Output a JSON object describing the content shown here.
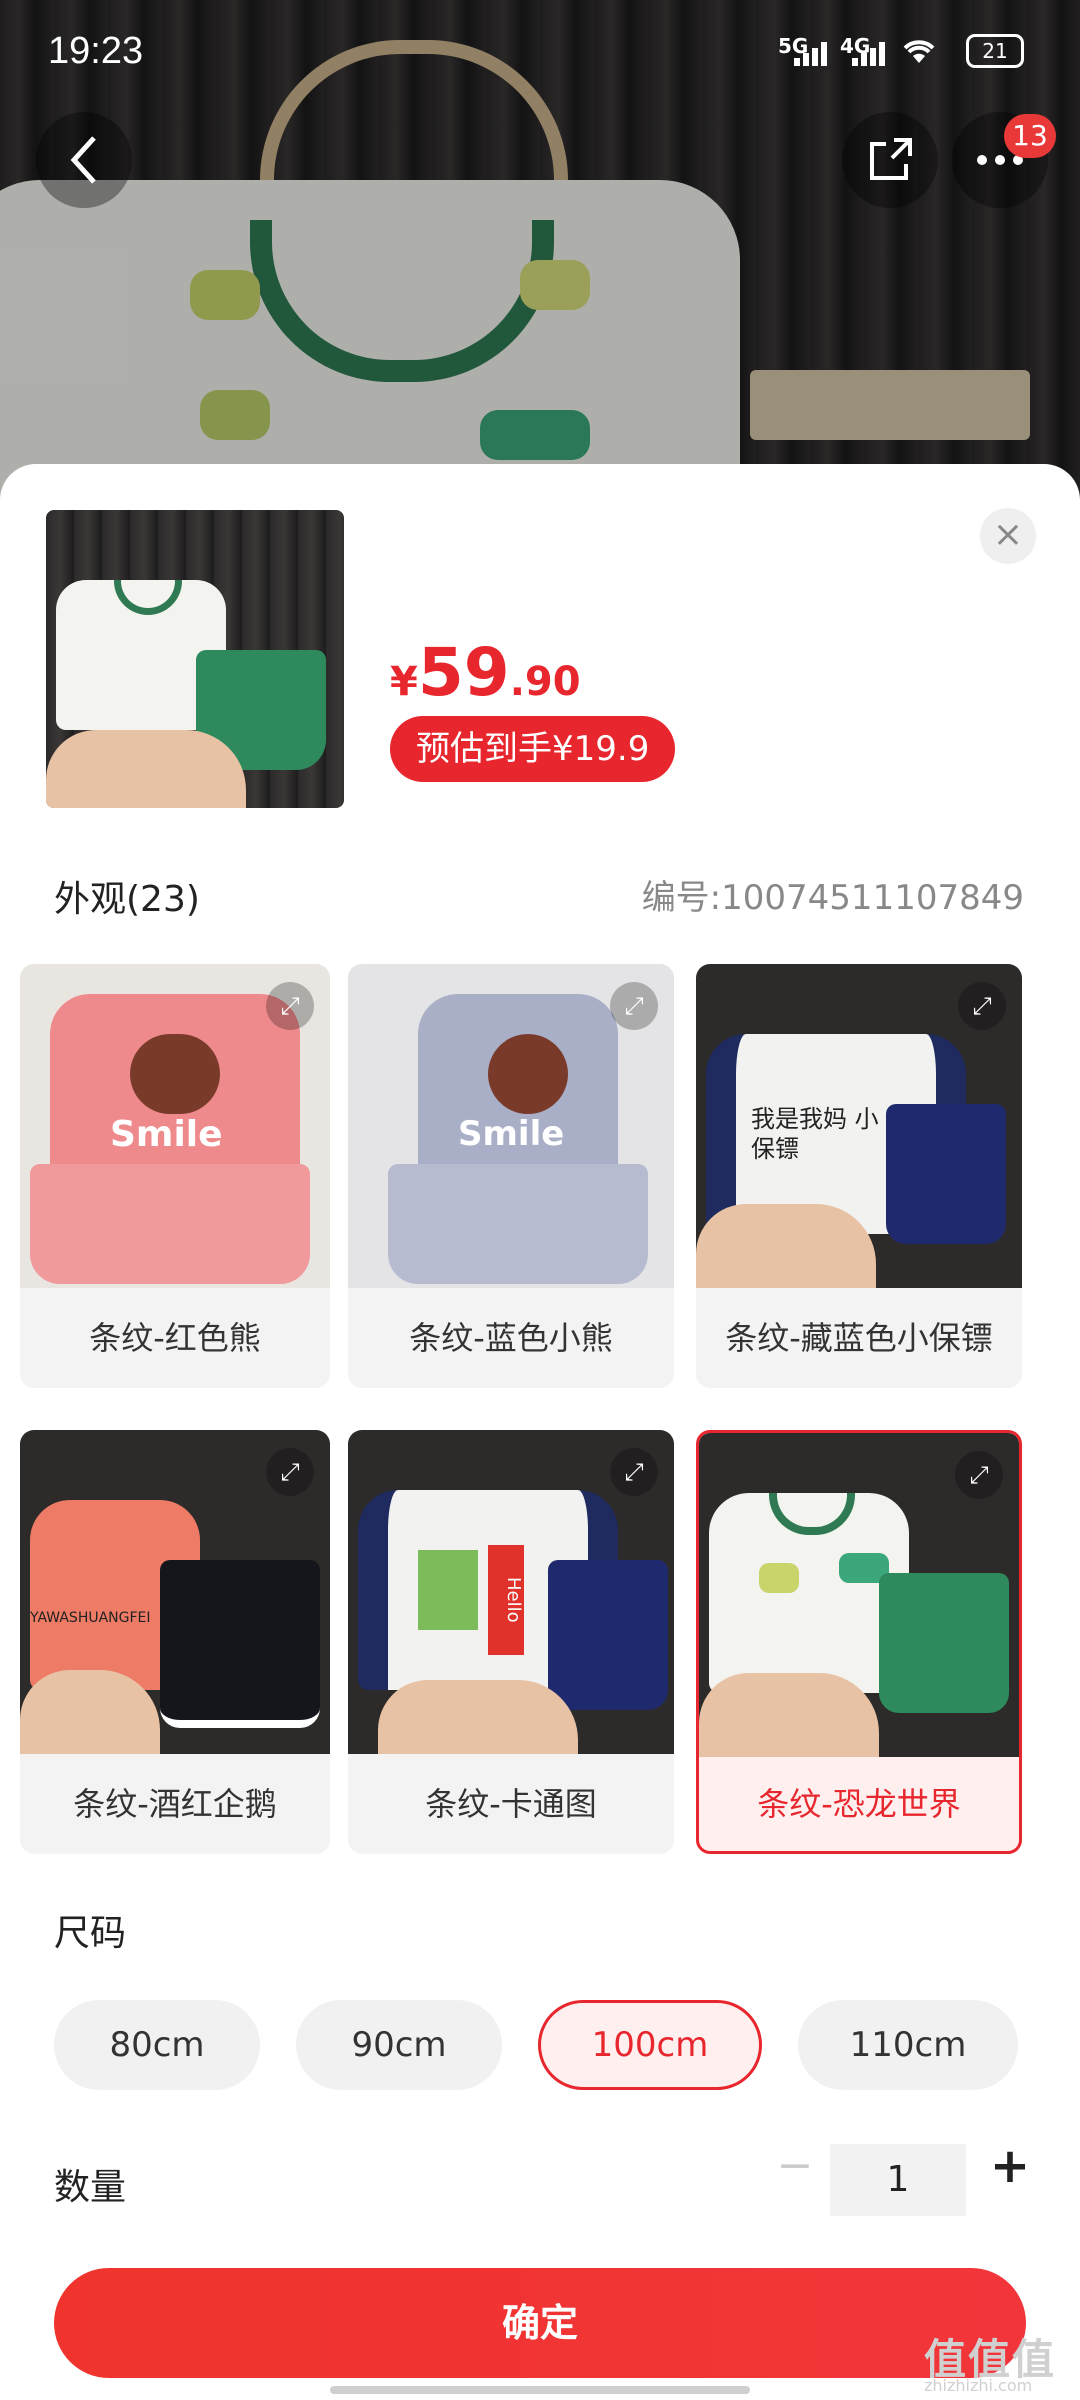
{
  "status_bar": {
    "time": "19:23",
    "sig1": "5G",
    "sig2": "4G",
    "battery": "21"
  },
  "nav": {
    "badge_count": "13"
  },
  "product": {
    "price_currency": "¥",
    "price_int": "59",
    "price_dec": ".90",
    "estimate_label": "预估到手¥19.9"
  },
  "appearance": {
    "title": "外观(23)",
    "code": "编号:10074511107849",
    "options": [
      {
        "label": "条纹-红色熊",
        "selected": false
      },
      {
        "label": "条纹-蓝色小熊",
        "selected": false
      },
      {
        "label": "条纹-藏蓝色小保镖",
        "selected": false
      },
      {
        "label": "条纹-酒红企鹅",
        "selected": false
      },
      {
        "label": "条纹-卡通图",
        "selected": false
      },
      {
        "label": "条纹-恐龙世界",
        "selected": true
      }
    ],
    "card_texts": {
      "smile1": "Smile",
      "smile2": "Smile",
      "baobiao": "我是我妈 小保镖",
      "penguin": "YAWASHUANGFEI",
      "hello": "Hello"
    }
  },
  "size": {
    "title": "尺码",
    "options": [
      "80cm",
      "90cm",
      "100cm",
      "110cm"
    ],
    "selected": "100cm"
  },
  "quantity": {
    "title": "数量",
    "minus": "−",
    "value": "1",
    "plus": "+"
  },
  "confirm_label": "确定",
  "watermark": {
    "main": "值值值",
    "sub": "zhizhizhi.com"
  },
  "colors": {
    "accent": "#e8262d"
  }
}
